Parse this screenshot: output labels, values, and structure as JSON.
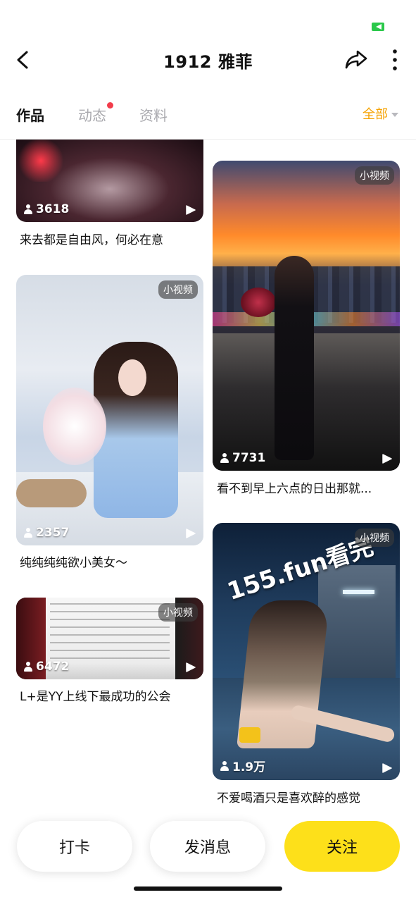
{
  "header": {
    "title": "1912 雅菲",
    "back_icon": "chevron-left-icon",
    "share_icon": "share-icon",
    "more_icon": "more-vertical-icon"
  },
  "tabs": [
    {
      "label": "作品",
      "active": true
    },
    {
      "label": "动态",
      "active": false,
      "has_dot": true
    },
    {
      "label": "资料",
      "active": false
    }
  ],
  "filter": {
    "label": "全部"
  },
  "cards": {
    "left": [
      {
        "views": "3618",
        "caption": "来去都是自由风，何必在意",
        "badge": ""
      },
      {
        "views": "2357",
        "caption": "纯纯纯纯欲小美女～",
        "badge": "小视频"
      },
      {
        "views": "6472",
        "caption": "L+是YY上线下最成功的公会",
        "badge": "小视频"
      }
    ],
    "right": [
      {
        "views": "7731",
        "caption": "看不到早上六点的日出那就...",
        "badge": "小视频"
      },
      {
        "views": "1.9万",
        "caption": "不爱喝酒只是喜欢醉的感觉",
        "badge": "小视频",
        "watermark": "155.fun看完"
      }
    ]
  },
  "actions": {
    "checkin": "打卡",
    "message": "发消息",
    "follow": "关注"
  },
  "colors": {
    "accent_yellow": "#fde01a",
    "filter_orange": "#f5a200",
    "notify_red": "#f23c4b",
    "battery_green": "#2ac84a"
  }
}
